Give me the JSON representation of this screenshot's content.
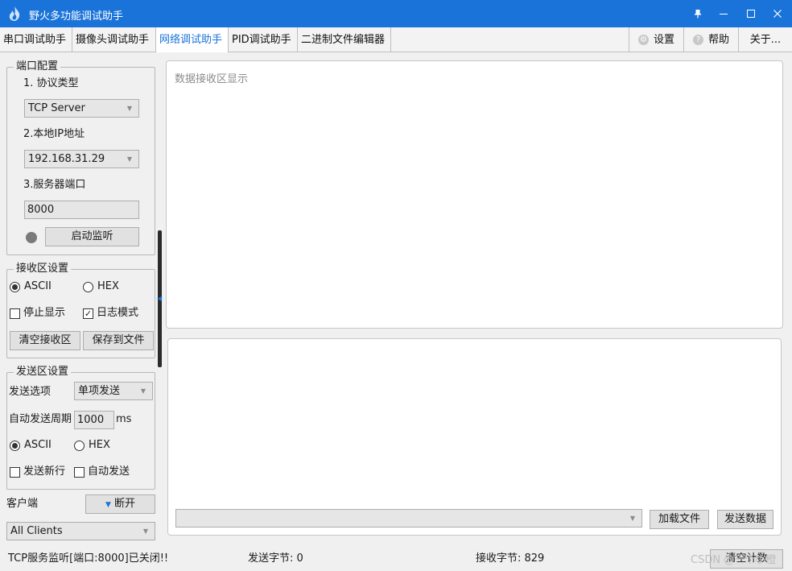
{
  "window": {
    "title": "野火多功能调试助手",
    "controls": [
      "pin-icon",
      "minimize-icon",
      "maximize-icon",
      "close-icon"
    ]
  },
  "tabs": [
    {
      "label": "串口调试助手",
      "active": false
    },
    {
      "label": "摄像头调试助手",
      "active": false
    },
    {
      "label": "网络调试助手",
      "active": true
    },
    {
      "label": "PID调试助手",
      "active": false
    },
    {
      "label": "二进制文件编辑器",
      "active": false
    }
  ],
  "right_tabs": {
    "settings": "设置",
    "help": "帮助",
    "about": "关于..."
  },
  "port_config": {
    "legend": "端口配置",
    "protocol_label": "1. 协议类型",
    "protocol_value": "TCP Server",
    "ip_label": "2.本地IP地址",
    "ip_value": "192.168.31.29",
    "port_label": "3.服务器端口",
    "port_value": "8000",
    "listen_button": "启动监听",
    "status_color": "#7a7a7a"
  },
  "receive_config": {
    "legend": "接收区设置",
    "ascii": "ASCII",
    "hex": "HEX",
    "ascii_checked": true,
    "stop_display": "停止显示",
    "stop_display_checked": false,
    "log_mode": "日志模式",
    "log_mode_checked": true,
    "clear_button": "清空接收区",
    "save_button": "保存到文件"
  },
  "send_config": {
    "legend": "发送区设置",
    "send_option_label": "发送选项",
    "send_option_value": "单项发送",
    "period_label": "自动发送周期",
    "period_value": "1000",
    "period_unit": "ms",
    "ascii": "ASCII",
    "hex": "HEX",
    "ascii_checked": true,
    "new_line": "发送新行",
    "new_line_checked": false,
    "auto_send": "自动发送",
    "auto_send_checked": false
  },
  "client": {
    "label": "客户端",
    "disconnect_button": "断开",
    "clients_value": "All Clients"
  },
  "receive_area": {
    "placeholder": "数据接收区显示"
  },
  "send_area": {
    "load_file_button": "加载文件",
    "send_button": "发送数据"
  },
  "status_bar": {
    "message": "TCP服务监听[端口:8000]已关闭!!",
    "sent_bytes": "发送字节: 0",
    "received_bytes": "接收字节: 829",
    "clear_count_button": "清空计数",
    "watermark": "CSDN @一个小橙"
  },
  "colors": {
    "accent": "#1a73d9",
    "titlebar": "#1a73d9"
  }
}
